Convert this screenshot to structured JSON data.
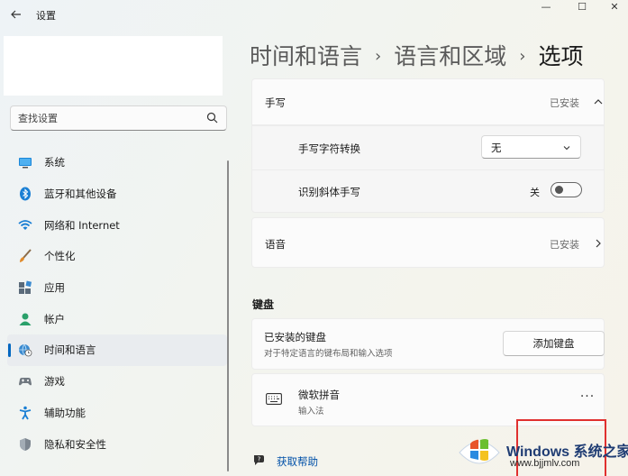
{
  "window": {
    "title": "设置",
    "back_icon": "arrow-left-icon",
    "minimize": "—",
    "maximize": "☐",
    "close": "✕"
  },
  "search": {
    "placeholder": "查找设置",
    "icon": "search-icon"
  },
  "sidebar": {
    "items": [
      {
        "label": "系统",
        "icon": "monitor-icon",
        "active": false
      },
      {
        "label": "蓝牙和其他设备",
        "icon": "bluetooth-icon",
        "active": false
      },
      {
        "label": "网络和 Internet",
        "icon": "wifi-icon",
        "active": false
      },
      {
        "label": "个性化",
        "icon": "brush-icon",
        "active": false
      },
      {
        "label": "应用",
        "icon": "apps-icon",
        "active": false
      },
      {
        "label": "帐户",
        "icon": "person-icon",
        "active": false
      },
      {
        "label": "时间和语言",
        "icon": "globe-clock-icon",
        "active": true
      },
      {
        "label": "游戏",
        "icon": "gamepad-icon",
        "active": false
      },
      {
        "label": "辅助功能",
        "icon": "accessibility-icon",
        "active": false
      },
      {
        "label": "隐私和安全性",
        "icon": "shield-icon",
        "active": false
      }
    ]
  },
  "breadcrumb": {
    "level1": "时间和语言",
    "level2": "语言和区域",
    "current": "选项",
    "separator": "›"
  },
  "handwriting": {
    "title": "手写",
    "status": "已安装",
    "conversion_label": "手写字符转换",
    "conversion_value": "无",
    "italic_label": "识别斜体手写",
    "italic_toggle_text": "关",
    "italic_toggle_on": false
  },
  "speech": {
    "title": "语音",
    "status": "已安装"
  },
  "keyboard": {
    "section_title": "键盘",
    "installed_title": "已安装的键盘",
    "installed_desc": "对于特定语言的键布局和输入选项",
    "add_button": "添加键盘",
    "items": [
      {
        "name": "微软拼音",
        "type": "输入法",
        "icon": "keyboard-icon",
        "more": "···"
      }
    ]
  },
  "help": {
    "label": "获取帮助",
    "icon": "help-icon"
  },
  "watermark": {
    "brand_a": "Windows",
    "brand_b": " 系统之家",
    "url": "www.bjjmlv.com"
  },
  "colors": {
    "accent": "#0067c0",
    "highlight_box": "#e0302f",
    "link": "#0050a8"
  }
}
